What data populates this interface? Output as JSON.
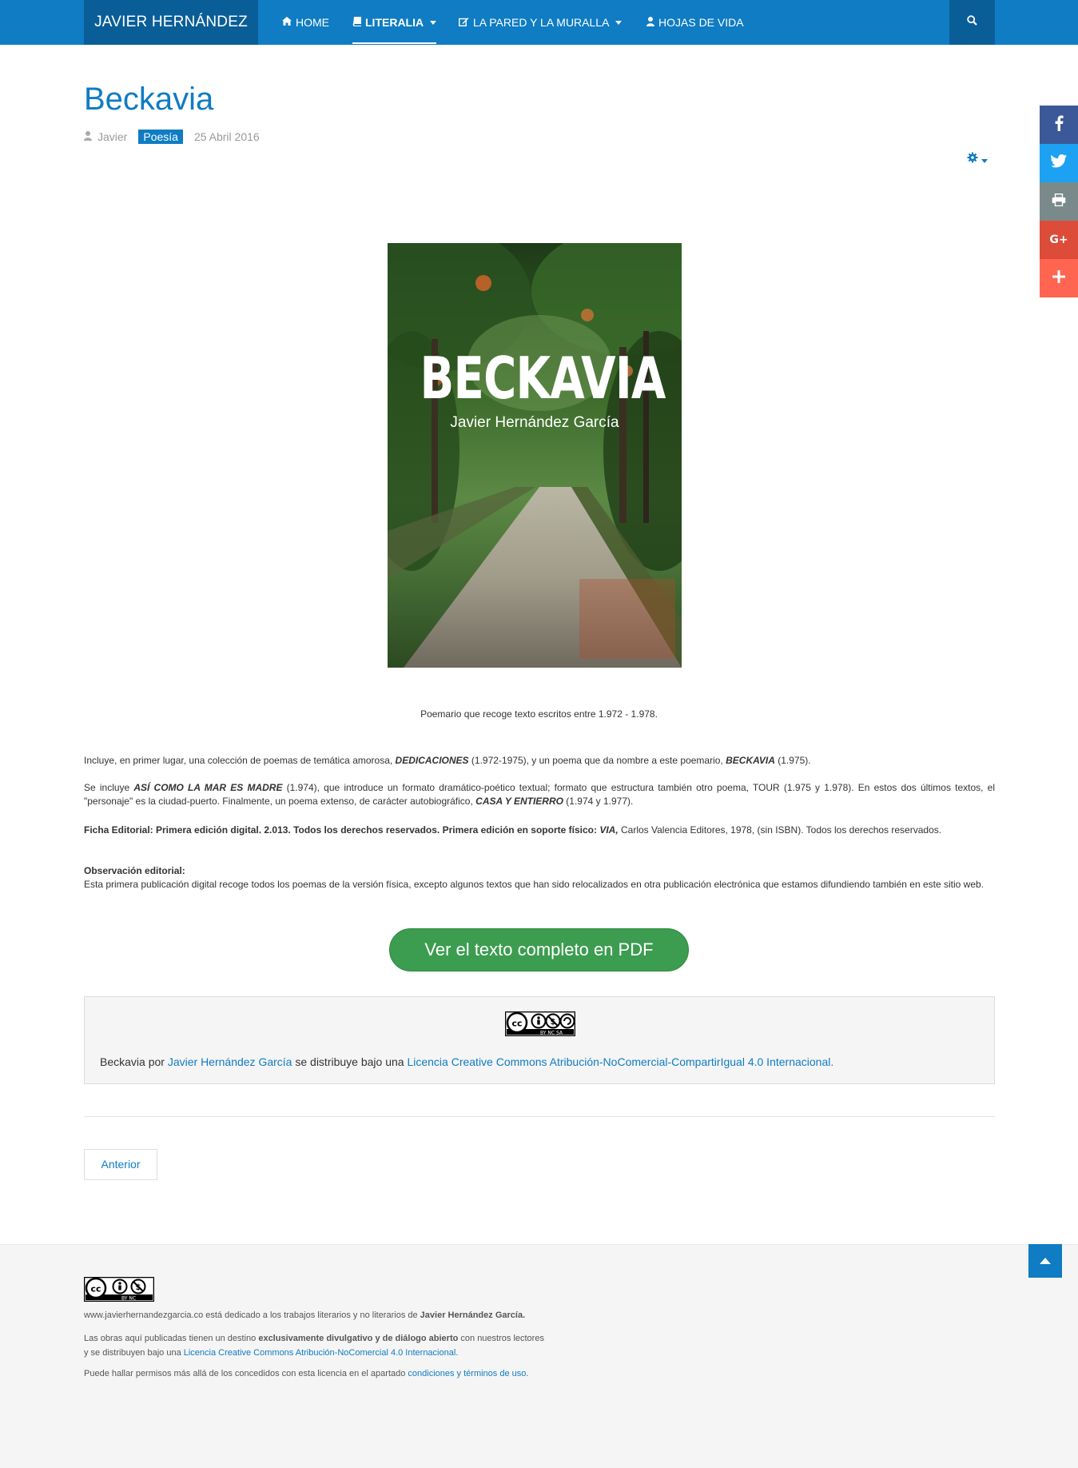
{
  "nav": {
    "brand": "JAVIER HERNÁNDEZ",
    "items": [
      {
        "label": "HOME",
        "icon": "home-icon"
      },
      {
        "label": "LITERALIA",
        "icon": "book-icon",
        "active": true
      },
      {
        "label": "LA PARED Y LA MURALLA",
        "icon": "edit-icon"
      },
      {
        "label": "HOJAS DE VIDA",
        "icon": "user-icon"
      }
    ],
    "search_icon": "search-icon"
  },
  "article": {
    "title": "Beckavia",
    "author": "Javier",
    "category": "Poesía",
    "date": "25 Abril 2016"
  },
  "cover": {
    "title": "BECKAVIA",
    "author": "Javier Hernández García"
  },
  "body": {
    "caption": "Poemario que recoge texto escritos entre 1.972 - 1.978.",
    "p1_a": "Incluye, en primer lugar, una colección de poemas de temática amorosa, ",
    "p1_b": "DEDICACIONES",
    "p1_c": " (1.972-1975), y un poema que da nombre a este poemario, ",
    "p1_d": "BECKAVIA",
    "p1_e": " (1.975).",
    "p2_a": "Se incluye ",
    "p2_b": "ASÍ COMO LA MAR ES MADRE",
    "p2_c": " (1.974), que introduce un formato dramático-poético textual; formato que estructura también otro poema, TOUR (1.975 y 1.978). En estos dos últimos textos, el \"personaje\" es la ciudad-puerto. Finalmente, un poema extenso, de carácter autobiográfico, ",
    "p2_d": "CASA Y ENTIERRO",
    "p2_e": " (1.974 y 1.977).",
    "p3_a": "Ficha Editorial: Primera edición digital. 2.013. Todos los derechos reservados. Primera edición en soporte físico: ",
    "p3_b": "VIA,",
    "p3_c": " Carlos Valencia Editores, 1978, (sin ISBN). Todos los derechos reservados.",
    "p4_title": "Observación editorial:",
    "p4_text": "Esta primera publicación digital recoge todos los poemas de la versión física, excepto algunos textos que han sido relocalizados en otra publicación electrónica que estamos difundiendo también en este sitio web.",
    "pdf_button": "Ver el texto completo en PDF"
  },
  "license": {
    "badge_text": "BY NC SA",
    "work": "Beckavia",
    "por": " por ",
    "author_link": "Javier Hernández García",
    "middle": " se distribuye bajo una ",
    "license_link": "Licencia Creative Commons Atribución-NoComercial-CompartirIgual 4.0 Internacional."
  },
  "pager": {
    "prev": "Anterior"
  },
  "footer": {
    "badge_text": "BY NC",
    "line1_a": "www.javierhernandezgarcia.co está dedicado a los trabajos literarios y no literarios de ",
    "line1_b": "Javier Hernández García.",
    "line2_a": "Las obras aquí publicadas tienen un destino ",
    "line2_b": "exclusivamente divulgativo y de diálogo abierto",
    "line2_c": " con nuestros lectores",
    "line3_a": "y se distribuyen bajo una ",
    "line3_b": "Licencia Creative Commons Atribución-NoComercial 4.0 Internacional",
    "line3_c": ".",
    "line4_a": "Puede hallar permisos más allá de los concedidos con esta licencia en el apartado ",
    "line4_b": "condiciones y términos de uso",
    "line4_c": "."
  },
  "social": {
    "items": [
      {
        "name": "facebook-icon",
        "color": "#3b5998"
      },
      {
        "name": "twitter-icon",
        "color": "#1da1f2"
      },
      {
        "name": "print-icon",
        "color": "#7a8a8a"
      },
      {
        "name": "google-plus-icon",
        "color": "#dd4b39"
      },
      {
        "name": "add-icon",
        "color": "#ff6550"
      }
    ]
  },
  "colors": {
    "primary": "#0f7cc3",
    "nav_dark": "#0a5e98",
    "pdf_green": "#3c9d50"
  }
}
